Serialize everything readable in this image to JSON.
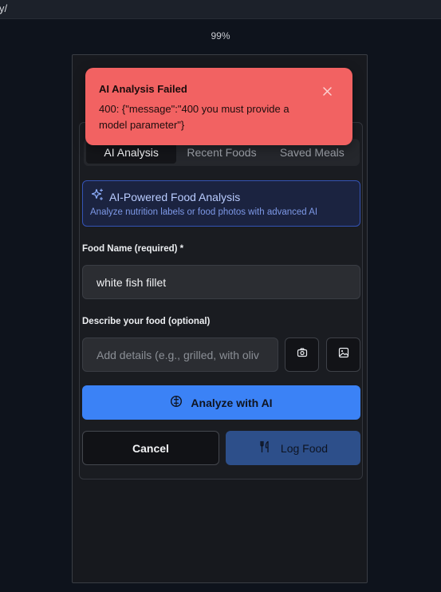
{
  "browser": {
    "url_fragment": "y/",
    "zoom": "99%"
  },
  "tabs": [
    {
      "label": "AI Analysis",
      "active": true
    },
    {
      "label": "Recent Foods",
      "active": false
    },
    {
      "label": "Saved Meals",
      "active": false
    }
  ],
  "ai_banner": {
    "icon": "sparkles-icon",
    "title": "AI-Powered Food Analysis",
    "subtitle": "Analyze nutrition labels or food photos with advanced AI"
  },
  "form": {
    "food_name_label": "Food Name (required) *",
    "food_name_value": "white fish fillet",
    "describe_label": "Describe your food (optional)",
    "describe_placeholder": "Add details (e.g., grilled, with oliv"
  },
  "buttons": {
    "camera_icon": "camera-icon",
    "image_icon": "image-icon",
    "analyze_label": "Analyze with AI",
    "cancel_label": "Cancel",
    "log_label": "Log Food"
  },
  "toast": {
    "title": "AI Analysis Failed",
    "message": "400: {\"message\":\"400 you must provide a model parameter\"}"
  },
  "colors": {
    "primary": "#3b82f6",
    "error": "#f26262",
    "accent_border": "#3453b5"
  }
}
